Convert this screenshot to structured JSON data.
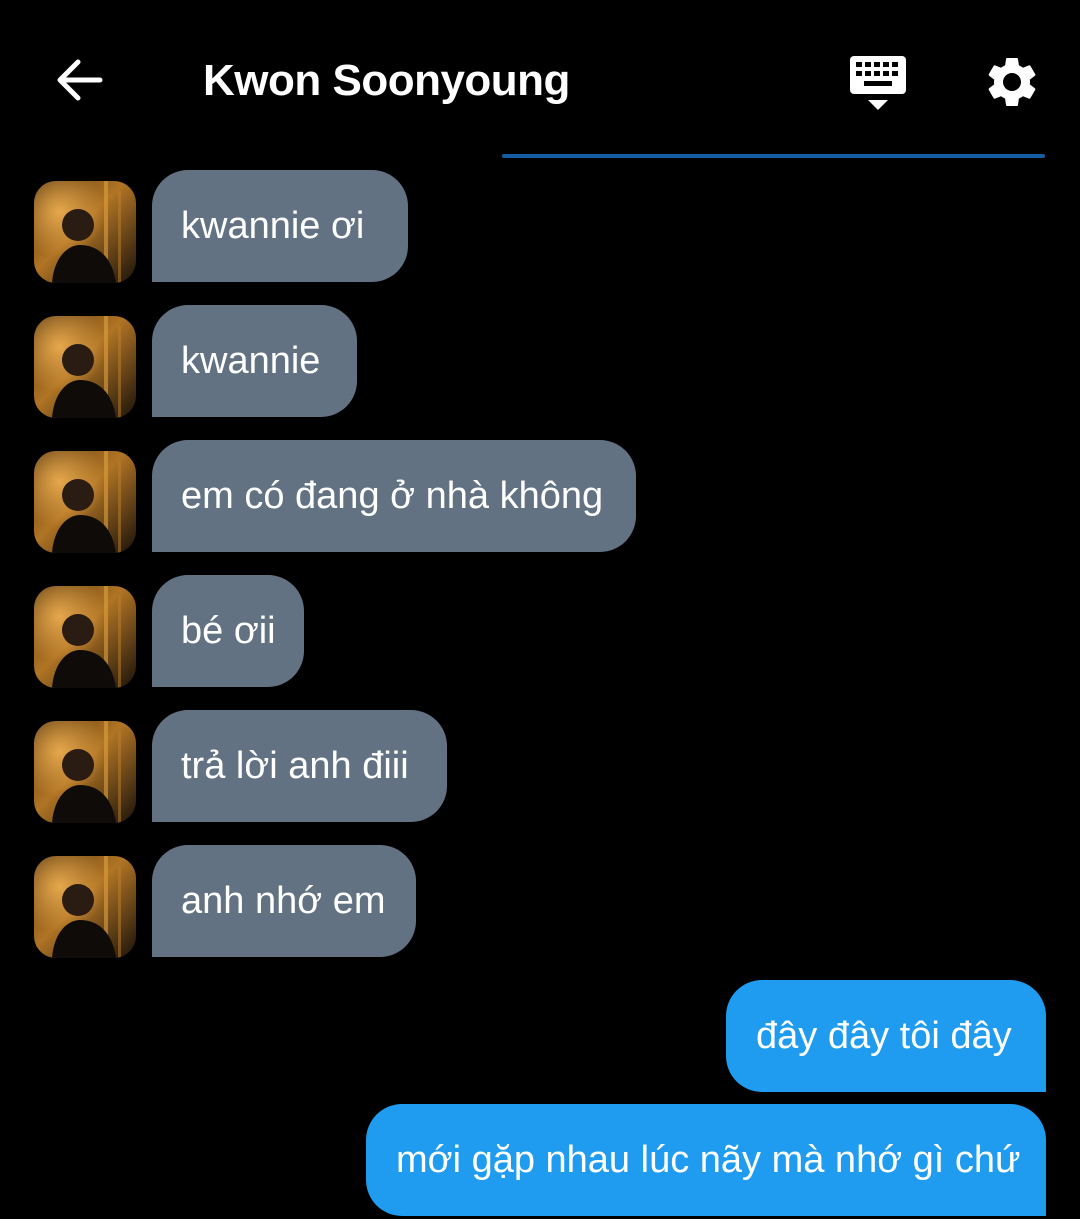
{
  "header": {
    "title": "Kwon Soonyoung",
    "back_icon": "arrow-left-icon",
    "keyboard_icon": "keyboard-icon",
    "settings_icon": "gear-icon"
  },
  "colors": {
    "background": "#000000",
    "incoming_bubble": "#627282",
    "outgoing_bubble": "#1f9bf0",
    "accent_line": "#1a6fc0"
  },
  "messages": [
    {
      "sender": "them",
      "text": "kwannie ơi"
    },
    {
      "sender": "them",
      "text": "kwannie"
    },
    {
      "sender": "them",
      "text": "em có đang ở nhà không"
    },
    {
      "sender": "them",
      "text": "bé ơii"
    },
    {
      "sender": "them",
      "text": "trả lời anh điii"
    },
    {
      "sender": "them",
      "text": "anh nhớ em"
    },
    {
      "sender": "me",
      "text": "đây đây tôi đây"
    },
    {
      "sender": "me",
      "text": "mới gặp nhau lúc nãy mà nhớ gì chứ"
    }
  ]
}
